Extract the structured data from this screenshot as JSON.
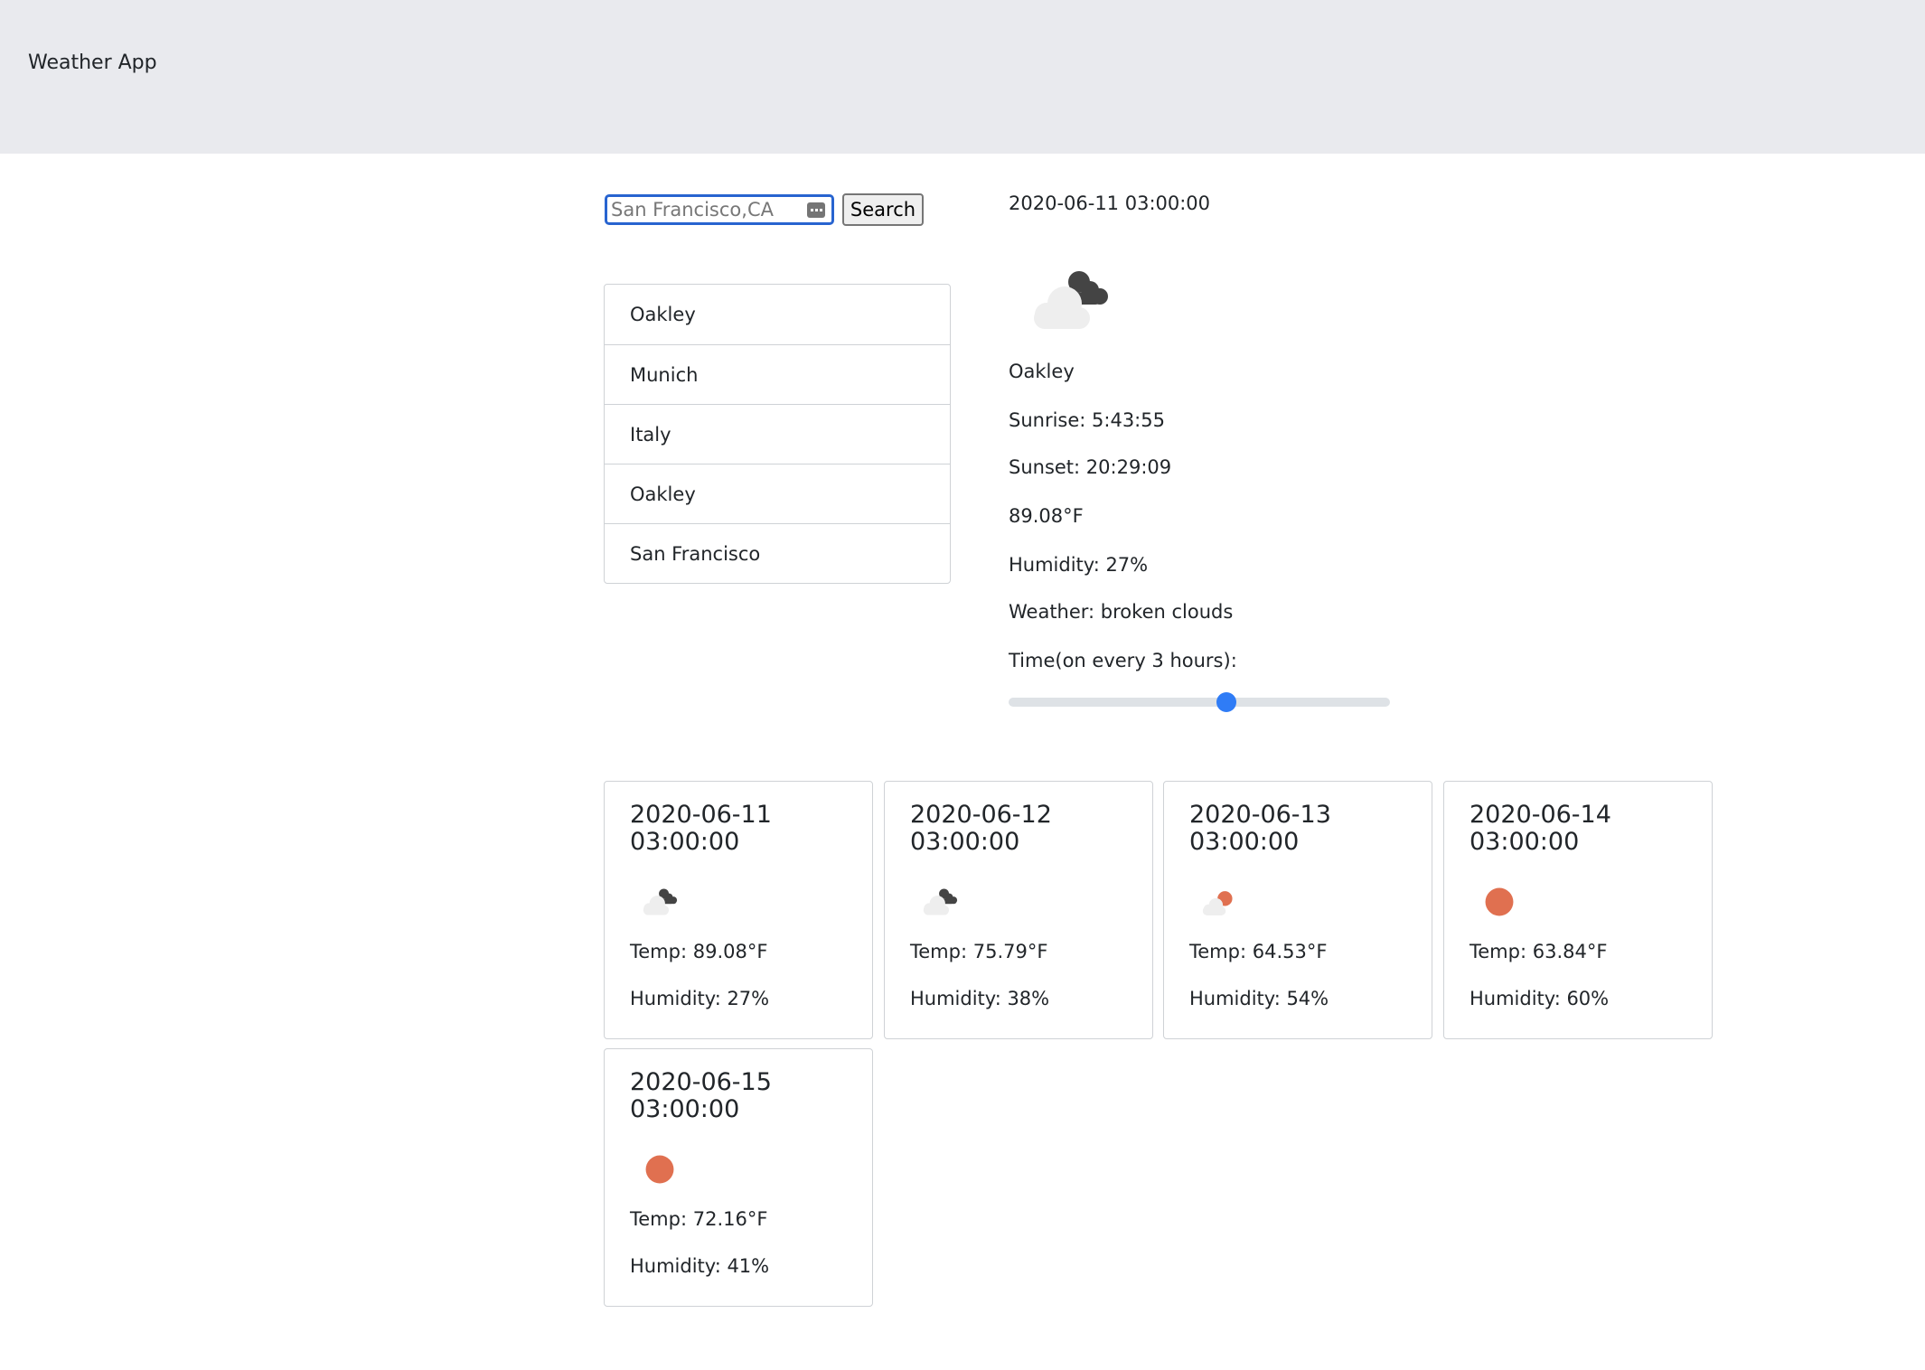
{
  "app": {
    "title": "Weather App"
  },
  "search": {
    "value": "",
    "placeholder": "San Francisco,CA",
    "button_label": "Search"
  },
  "cities": [
    "Oakley",
    "Munich",
    "Italy",
    "Oakley",
    "San Francisco"
  ],
  "current": {
    "datetime": "2020-06-11 03:00:00",
    "icon": "broken-clouds-icon",
    "city": "Oakley",
    "sunrise": "Sunrise: 5:43:55",
    "sunset": "Sunset: 20:29:09",
    "temp": "89.08°F",
    "humidity": "Humidity: 27%",
    "weather": "Weather: broken clouds",
    "slider_label": "Time(on every 3 hours):",
    "slider_value": 0.57
  },
  "forecast": [
    {
      "date": "2020-06-11 03:00:00",
      "icon": "broken-clouds-icon",
      "temp": "Temp: 89.08°F",
      "humidity": "Humidity: 27%"
    },
    {
      "date": "2020-06-12 03:00:00",
      "icon": "broken-clouds-icon",
      "temp": "Temp: 75.79°F",
      "humidity": "Humidity: 38%"
    },
    {
      "date": "2020-06-13 03:00:00",
      "icon": "few-clouds-icon",
      "temp": "Temp: 64.53°F",
      "humidity": "Humidity: 54%"
    },
    {
      "date": "2020-06-14 03:00:00",
      "icon": "clear-sky-icon",
      "temp": "Temp: 63.84°F",
      "humidity": "Humidity: 60%"
    },
    {
      "date": "2020-06-15 03:00:00",
      "icon": "clear-sky-icon",
      "temp": "Temp: 72.16°F",
      "humidity": "Humidity: 41%"
    }
  ],
  "colors": {
    "navbar": "#e9eaee",
    "accent": "#2f7cf6",
    "sun": "#e07050",
    "cloud_dark": "#444444",
    "cloud_light": "#eeeeee"
  }
}
